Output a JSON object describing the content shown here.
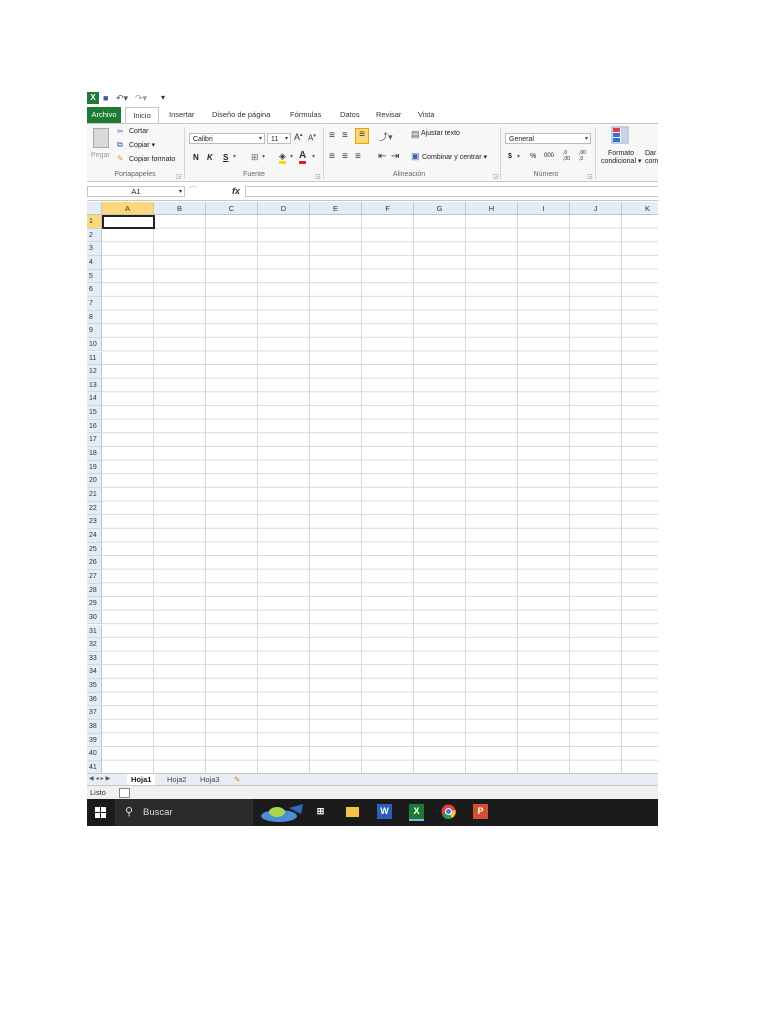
{
  "colors": {
    "excel_green": "#1e7b34",
    "header_bg": "#e4ecf7",
    "selected_header": "#f9d97a",
    "taskbar": "#1b1b1b"
  },
  "tabs": [
    "Archivo",
    "Inicio",
    "Insertar",
    "Diseño de página",
    "Fórmulas",
    "Datos",
    "Revisar",
    "Vista"
  ],
  "ribbon": {
    "clipboard": {
      "paste": "Pegar",
      "cut": "Cortar",
      "copy": "Copiar",
      "copy_arrow": "▾",
      "format_painter": "Copiar formato",
      "label": "Portapapeles"
    },
    "font": {
      "name": "Calibri",
      "size": "11",
      "bold": "N",
      "italic": "K",
      "underline": "S",
      "label": "Fuente"
    },
    "alignment": {
      "wrap": "Ajustar texto",
      "merge": "Combinar y centrar",
      "merge_arrow": "▾",
      "label": "Alineación"
    },
    "number": {
      "format": "General",
      "currency": "$",
      "percent": "%",
      "thousands": "000",
      "inc_decimal": ",0 ,00",
      "dec_decimal": ",00 ,0",
      "label": "Número"
    },
    "styles": {
      "conditional_1": "Formato",
      "conditional_2": "condicional",
      "conditional_arrow": "▾",
      "table_1": "Dar",
      "table_2": "com"
    }
  },
  "formula_bar": {
    "name_box": "A1",
    "fx": "fx",
    "value": ""
  },
  "columns": [
    "A",
    "B",
    "C",
    "D",
    "E",
    "F",
    "G",
    "H",
    "I",
    "J",
    "K"
  ],
  "rows": [
    "1",
    "2",
    "3",
    "4",
    "5",
    "6",
    "7",
    "8",
    "9",
    "10",
    "11",
    "12",
    "13",
    "14",
    "15",
    "16",
    "17",
    "18",
    "19",
    "20",
    "21",
    "22",
    "23",
    "24",
    "25",
    "26",
    "27",
    "28",
    "29",
    "30",
    "31",
    "32",
    "33",
    "34",
    "35",
    "36",
    "37",
    "38",
    "39",
    "40",
    "41"
  ],
  "sheets": [
    "Hoja1",
    "Hoja2",
    "Hoja3"
  ],
  "status": "Listo",
  "taskbar": {
    "search": "Buscar",
    "apps": [
      "task-view",
      "file-explorer",
      "word",
      "excel",
      "chrome",
      "powerpoint"
    ]
  }
}
